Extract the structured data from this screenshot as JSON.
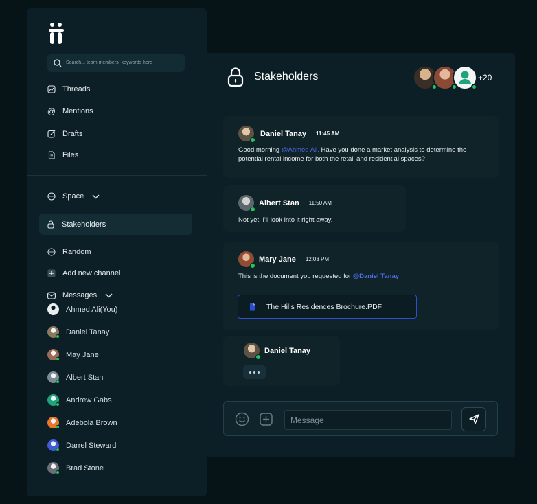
{
  "search": {
    "placeholder": "Search... team members, keywords here"
  },
  "nav": [
    {
      "label": "Threads",
      "icon": "threads-icon"
    },
    {
      "label": "Mentions",
      "icon": "at-icon"
    },
    {
      "label": "Drafts",
      "icon": "draft-icon"
    },
    {
      "label": "Files",
      "icon": "file-icon"
    }
  ],
  "space": {
    "label": "Space"
  },
  "channels": {
    "active": "Stakeholders",
    "random": "Random",
    "add": "Add new channel"
  },
  "messages_section": {
    "label": "Messages"
  },
  "dms": [
    {
      "name": "Ahmed Ali(You)",
      "color": "#e8eef0",
      "online": false
    },
    {
      "name": "Daniel Tanay",
      "color": "#8b7a5e",
      "online": true
    },
    {
      "name": "May Jane",
      "color": "#9a6a55",
      "online": true
    },
    {
      "name": "Albert Stan",
      "color": "#7c8a94",
      "online": true
    },
    {
      "name": "Andrew Gabs",
      "color": "#1fa37a",
      "online": true
    },
    {
      "name": "Adebola Brown",
      "color": "#e8792b",
      "online": true
    },
    {
      "name": "Darrel Steward",
      "color": "#3f5bd6",
      "online": true
    },
    {
      "name": "Brad Stone",
      "color": "#6b6f78",
      "online": true
    }
  ],
  "channel": {
    "title": "Stakeholders",
    "members_more": "+20"
  },
  "chat": [
    {
      "name": "Daniel Tanay",
      "time": "11:45 AM",
      "text_before": "Good morning ",
      "mention": "@Ahmed Ali.",
      "text_after": " Have you done a market analysis to determine the potential rental income for both the retail and residential spaces?"
    },
    {
      "name": "Albert Stan",
      "time": "11:50 AM",
      "text": "Not yet. I'll look into it right away."
    },
    {
      "name": "Mary Jane",
      "time": "12:03 PM",
      "text_before": "This is the document you requested for ",
      "mention": "@Daniel Tanay",
      "attachment": "The Hills Residences Brochure.PDF"
    },
    {
      "name": "Daniel Tanay",
      "typing": true
    }
  ],
  "composer": {
    "placeholder": "Message"
  },
  "colors": {
    "accent": "#2c4fd0",
    "online": "#22c55e",
    "background": "#071417",
    "panel": "#0d1f26"
  }
}
